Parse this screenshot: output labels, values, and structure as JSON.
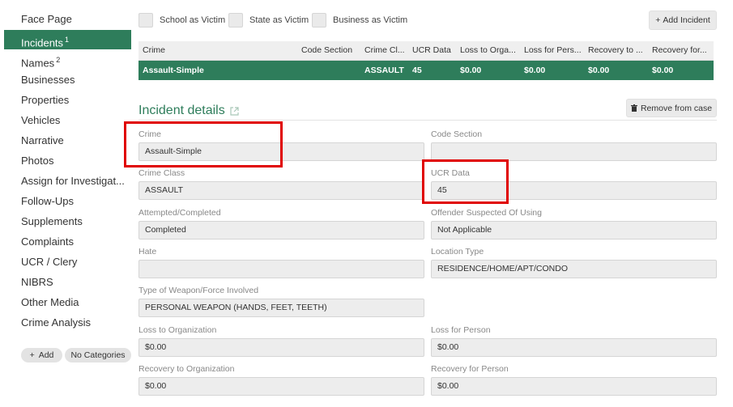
{
  "sidebar": {
    "items": [
      {
        "label": "Face Page"
      },
      {
        "label": "Incidents",
        "badge": "1"
      },
      {
        "label": "Names",
        "badge": "2"
      },
      {
        "label": "Businesses"
      },
      {
        "label": "Properties"
      },
      {
        "label": "Vehicles"
      },
      {
        "label": "Narrative"
      },
      {
        "label": "Photos"
      },
      {
        "label": "Assign for Investigat..."
      },
      {
        "label": "Follow-Ups"
      },
      {
        "label": "Supplements"
      },
      {
        "label": "Complaints"
      },
      {
        "label": "UCR / Clery"
      },
      {
        "label": "NIBRS"
      },
      {
        "label": "Other Media"
      },
      {
        "label": "Crime Analysis"
      }
    ],
    "add_label": "Add",
    "categories_label": "No Categories"
  },
  "filters": {
    "school": "School as Victim",
    "state": "State as Victim",
    "business": "Business as Victim"
  },
  "add_incident_label": "Add Incident",
  "table": {
    "headers": [
      "Crime",
      "Code Section",
      "Crime Cl...",
      "UCR Data",
      "Loss to Orga...",
      "Loss for Pers...",
      "Recovery to ...",
      "Recovery for..."
    ],
    "rows": [
      [
        "Assault-Simple",
        "",
        "ASSAULT",
        "45",
        "$0.00",
        "$0.00",
        "$0.00",
        "$0.00"
      ]
    ]
  },
  "details": {
    "title": "Incident details",
    "remove_label": "Remove from case",
    "fields": {
      "crime": {
        "label": "Crime",
        "value": "Assault-Simple"
      },
      "code_section": {
        "label": "Code Section",
        "value": ""
      },
      "crime_class": {
        "label": "Crime Class",
        "value": "ASSAULT"
      },
      "ucr_data": {
        "label": "UCR Data",
        "value": "45"
      },
      "attempted": {
        "label": "Attempted/Completed",
        "value": "Completed"
      },
      "offender": {
        "label": "Offender Suspected Of Using",
        "value": "Not Applicable"
      },
      "hate": {
        "label": "Hate",
        "value": ""
      },
      "location": {
        "label": "Location Type",
        "value": "RESIDENCE/HOME/APT/CONDO"
      },
      "weapon": {
        "label": "Type of Weapon/Force Involved",
        "value": "PERSONAL WEAPON (HANDS, FEET, TEETH)"
      },
      "loss_org": {
        "label": "Loss to Organization",
        "value": "$0.00"
      },
      "loss_person": {
        "label": "Loss for Person",
        "value": "$0.00"
      },
      "rec_org": {
        "label": "Recovery to Organization",
        "value": "$0.00"
      },
      "rec_person": {
        "label": "Recovery for Person",
        "value": "$0.00"
      }
    }
  },
  "colors": {
    "accent": "#2e7d5b",
    "highlight": "#e00000"
  }
}
